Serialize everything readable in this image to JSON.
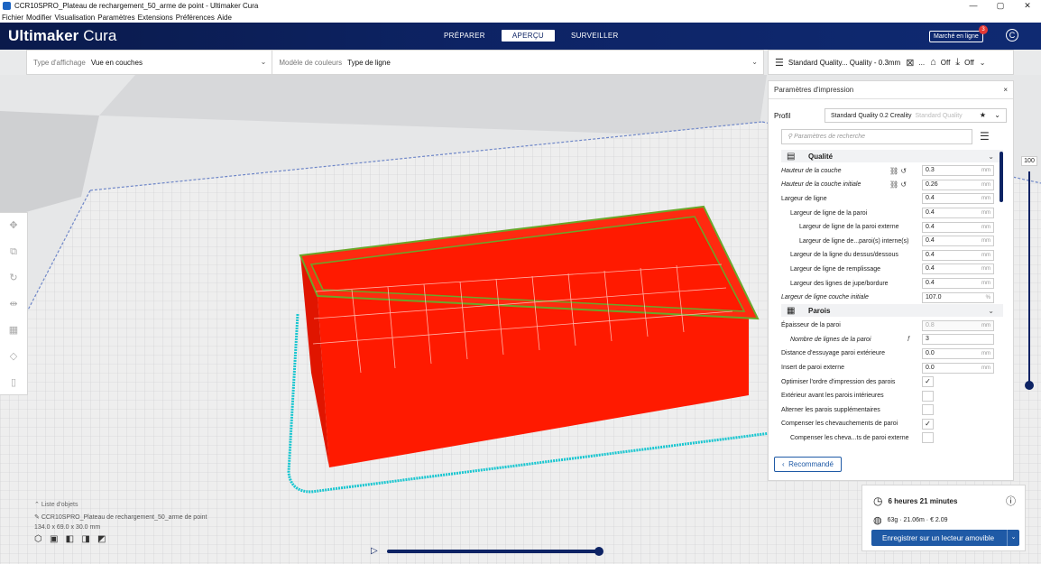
{
  "window": {
    "title": "CCR10SPRO_Plateau de rechargement_50_arme de point - Ultimaker Cura",
    "controls": [
      "—",
      "▢",
      "✕"
    ]
  },
  "menu": [
    "Fichier",
    "Modifier",
    "Visualisation",
    "Paramètres",
    "Extensions",
    "Préférences",
    "Aide"
  ],
  "header": {
    "brand_bold": "Ultimaker",
    "brand_light": "Cura",
    "stages": [
      "PRÉPARER",
      "APERÇU",
      "SURVEILLER"
    ],
    "active_stage": "APERÇU",
    "marketplace": "Marché en ligne",
    "notification_count": "3",
    "account_icon": "C"
  },
  "viewbar": {
    "display_type_label": "Type d'affichage",
    "display_type_value": "Vue en couches",
    "color_model_label": "Modèle de couleurs",
    "color_model_value": "Type de ligne"
  },
  "printbar": {
    "profile": "Standard Quality... Quality - 0.3mm",
    "support_text": "...",
    "adhesion_value": "Off",
    "extra_value": "Off"
  },
  "panel": {
    "title": "Paramètres d'impression",
    "close": "×",
    "profile_label": "Profil",
    "profile_value": "Standard Quality 0.2 Creality",
    "profile_suffix": "Standard Quality",
    "search_placeholder": "Paramètres de recherche",
    "recommended": "Recommandé",
    "categories": {
      "quality": "Qualité",
      "walls": "Parois"
    },
    "quality_rows": [
      {
        "label": "Hauteur de la couche",
        "value": "0.3",
        "unit": "mm"
      },
      {
        "label": "Hauteur de la couche initiale",
        "value": "0.26",
        "unit": "mm"
      },
      {
        "label": "Largeur de ligne",
        "value": "0.4",
        "unit": "mm"
      },
      {
        "label": "Largeur de ligne de la paroi",
        "value": "0.4",
        "unit": "mm"
      },
      {
        "label": "Largeur de ligne de la paroi externe",
        "value": "0.4",
        "unit": "mm"
      },
      {
        "label": "Largeur de ligne de...paroi(s) interne(s)",
        "value": "0.4",
        "unit": "mm"
      },
      {
        "label": "Largeur de la ligne du dessus/dessous",
        "value": "0.4",
        "unit": "mm"
      },
      {
        "label": "Largeur de ligne de remplissage",
        "value": "0.4",
        "unit": "mm"
      },
      {
        "label": "Largeur des lignes de jupe/bordure",
        "value": "0.4",
        "unit": "mm"
      },
      {
        "label": "Largeur de ligne couche initiale",
        "value": "107.0",
        "unit": "%"
      }
    ],
    "wall_rows": [
      {
        "label": "Épaisseur de la paroi",
        "value": "0.8",
        "unit": "mm"
      },
      {
        "label": "Nombre de lignes de la paroi",
        "value": "3",
        "unit": ""
      },
      {
        "label": "Distance d'essuyage paroi extérieure",
        "value": "0.0",
        "unit": "mm"
      },
      {
        "label": "Insert de paroi externe",
        "value": "0.0",
        "unit": "mm"
      },
      {
        "label": "Optimiser l'ordre d'impression des parois",
        "value": "✓",
        "unit": ""
      },
      {
        "label": "Extérieur avant les parois intérieures",
        "value": "",
        "unit": ""
      },
      {
        "label": "Alterner les parois supplémentaires",
        "value": "",
        "unit": ""
      },
      {
        "label": "Compenser les chevauchements de paroi",
        "value": "✓",
        "unit": ""
      },
      {
        "label": "Compenser les cheva...ts de paroi externe",
        "value": "",
        "unit": ""
      }
    ]
  },
  "objects": {
    "header": "Liste d'objets",
    "name": "CCR10SPRO_Plateau de rechargement_50_arme de point",
    "dimensions": "134.0 x 69.0 x 30.0 mm"
  },
  "layer_slider": {
    "top_value": "100"
  },
  "action": {
    "time": "6 heures 21 minutes",
    "material": "63g · 21.06m · € 2.09",
    "save_button": "Enregistrer sur un lecteur amovible"
  },
  "colors": {
    "header": "#0d2364",
    "accent": "#1f5aa6",
    "model": "#ff1a00",
    "infill_line": "#6aa72a",
    "skirt": "#19c6d0"
  }
}
